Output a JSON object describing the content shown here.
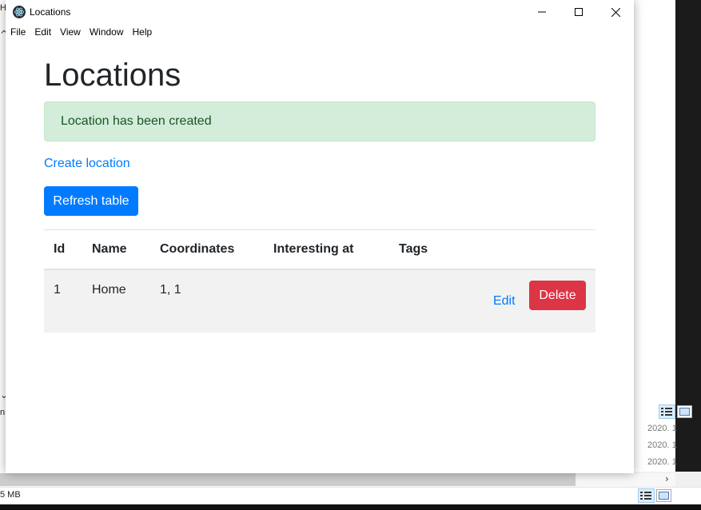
{
  "window": {
    "title": "Locations",
    "menu": [
      "File",
      "Edit",
      "View",
      "Window",
      "Help"
    ]
  },
  "page": {
    "heading": "Locations",
    "alert": "Location has been created",
    "create_link": "Create location",
    "refresh_button": "Refresh table"
  },
  "table": {
    "columns": [
      "Id",
      "Name",
      "Coordinates",
      "Interesting at",
      "Tags"
    ],
    "rows": [
      {
        "id": "1",
        "name": "Home",
        "coordinates": "1, 1",
        "interesting_at": "",
        "tags": "",
        "edit": "Edit",
        "delete": "Delete"
      }
    ]
  },
  "background": {
    "dates": [
      "2020. 1",
      "2020. 1",
      "2020. 1"
    ],
    "status_text": "5 MB",
    "left_stub_top": "H",
    "left_stub_mid": "n"
  },
  "colors": {
    "primary": "#007bff",
    "danger": "#dc3545",
    "alert_bg": "#d4edda",
    "alert_text": "#155724"
  }
}
